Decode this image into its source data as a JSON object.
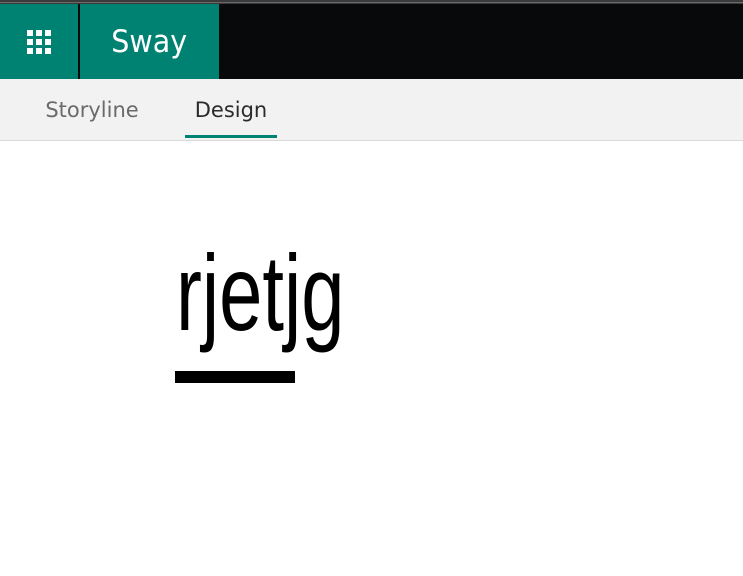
{
  "header": {
    "app_name": "Sway",
    "launcher_icon": "waffle-icon",
    "accent_color": "#008272",
    "bar_color": "#08090b"
  },
  "tabs": [
    {
      "label": "Storyline",
      "selected": false
    },
    {
      "label": "Design",
      "selected": true
    }
  ],
  "canvas": {
    "title": "rjetjg"
  }
}
